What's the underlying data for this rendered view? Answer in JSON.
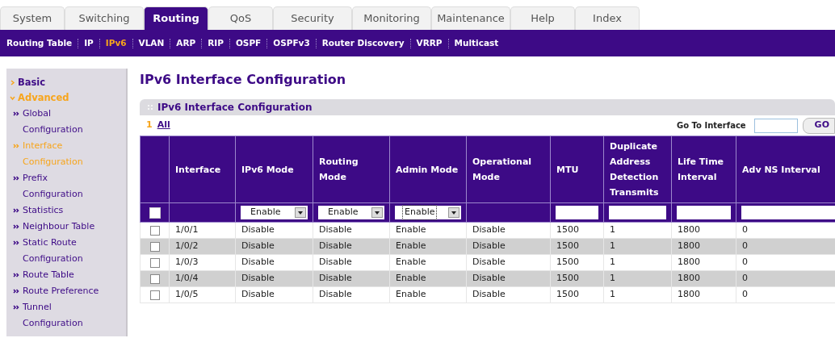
{
  "tabs": [
    {
      "label": "System",
      "selected": false
    },
    {
      "label": "Switching",
      "selected": false
    },
    {
      "label": "Routing",
      "selected": true
    },
    {
      "label": "QoS",
      "selected": false
    },
    {
      "label": "Security",
      "selected": false
    },
    {
      "label": "Monitoring",
      "selected": false
    },
    {
      "label": "Maintenance",
      "selected": false
    },
    {
      "label": "Help",
      "selected": false
    },
    {
      "label": "Index",
      "selected": false
    }
  ],
  "subnav": [
    {
      "label": "Routing Table",
      "selected": false
    },
    {
      "label": "IP",
      "selected": false
    },
    {
      "label": "IPv6",
      "selected": true
    },
    {
      "label": "VLAN",
      "selected": false
    },
    {
      "label": "ARP",
      "selected": false
    },
    {
      "label": "RIP",
      "selected": false
    },
    {
      "label": "OSPF",
      "selected": false
    },
    {
      "label": "OSPFv3",
      "selected": false
    },
    {
      "label": "Router Discovery",
      "selected": false
    },
    {
      "label": "VRRP",
      "selected": false
    },
    {
      "label": "Multicast",
      "selected": false
    }
  ],
  "sidebar": {
    "items": [
      {
        "label": "Basic",
        "expanded": false
      },
      {
        "label": "Advanced",
        "expanded": true,
        "children": [
          {
            "label": "Global Configuration",
            "selected": false
          },
          {
            "label": "Interface Configuration",
            "selected": true
          },
          {
            "label": "Prefix Configuration",
            "selected": false
          },
          {
            "label": "Statistics",
            "selected": false
          },
          {
            "label": "Neighbour Table",
            "selected": false
          },
          {
            "label": "Static Route Configuration",
            "selected": false
          },
          {
            "label": "Route Table",
            "selected": false
          },
          {
            "label": "Route Preference",
            "selected": false
          },
          {
            "label": "Tunnel Configuration",
            "selected": false
          }
        ]
      }
    ]
  },
  "page_title": "IPv6 Interface Configuration",
  "panel": {
    "title": "IPv6 Interface Configuration",
    "unit_number": "1",
    "unit_filter": "All",
    "go_to": {
      "label": "Go To Interface",
      "button": "GO"
    },
    "table": {
      "columns": [
        "Interface",
        "IPv6 Mode",
        "Routing Mode",
        "Admin Mode",
        "Operational Mode",
        "MTU",
        "Duplicate Address Detection Transmits",
        "Life Time Interval",
        "Adv NS Interval"
      ],
      "filter_row": {
        "checked": false,
        "cells": [
          {
            "kind": "blank"
          },
          {
            "kind": "select",
            "value": "Enable",
            "focused": false
          },
          {
            "kind": "select",
            "value": "Enable",
            "focused": false
          },
          {
            "kind": "select",
            "value": "Enable",
            "focused": true
          },
          {
            "kind": "blank"
          },
          {
            "kind": "input"
          },
          {
            "kind": "input"
          },
          {
            "kind": "input"
          },
          {
            "kind": "input"
          }
        ]
      },
      "rows": [
        {
          "checked": false,
          "cells": [
            "1/0/1",
            "Disable",
            "Disable",
            "Enable",
            "Disable",
            "1500",
            "1",
            "1800",
            "0"
          ]
        },
        {
          "checked": false,
          "cells": [
            "1/0/2",
            "Disable",
            "Disable",
            "Enable",
            "Disable",
            "1500",
            "1",
            "1800",
            "0"
          ]
        },
        {
          "checked": false,
          "cells": [
            "1/0/3",
            "Disable",
            "Disable",
            "Enable",
            "Disable",
            "1500",
            "1",
            "1800",
            "0"
          ]
        },
        {
          "checked": false,
          "cells": [
            "1/0/4",
            "Disable",
            "Disable",
            "Enable",
            "Disable",
            "1500",
            "1",
            "1800",
            "0"
          ]
        },
        {
          "checked": false,
          "cells": [
            "1/0/5",
            "Disable",
            "Disable",
            "Enable",
            "Disable",
            "1500",
            "1",
            "1800",
            "0"
          ]
        }
      ]
    }
  }
}
